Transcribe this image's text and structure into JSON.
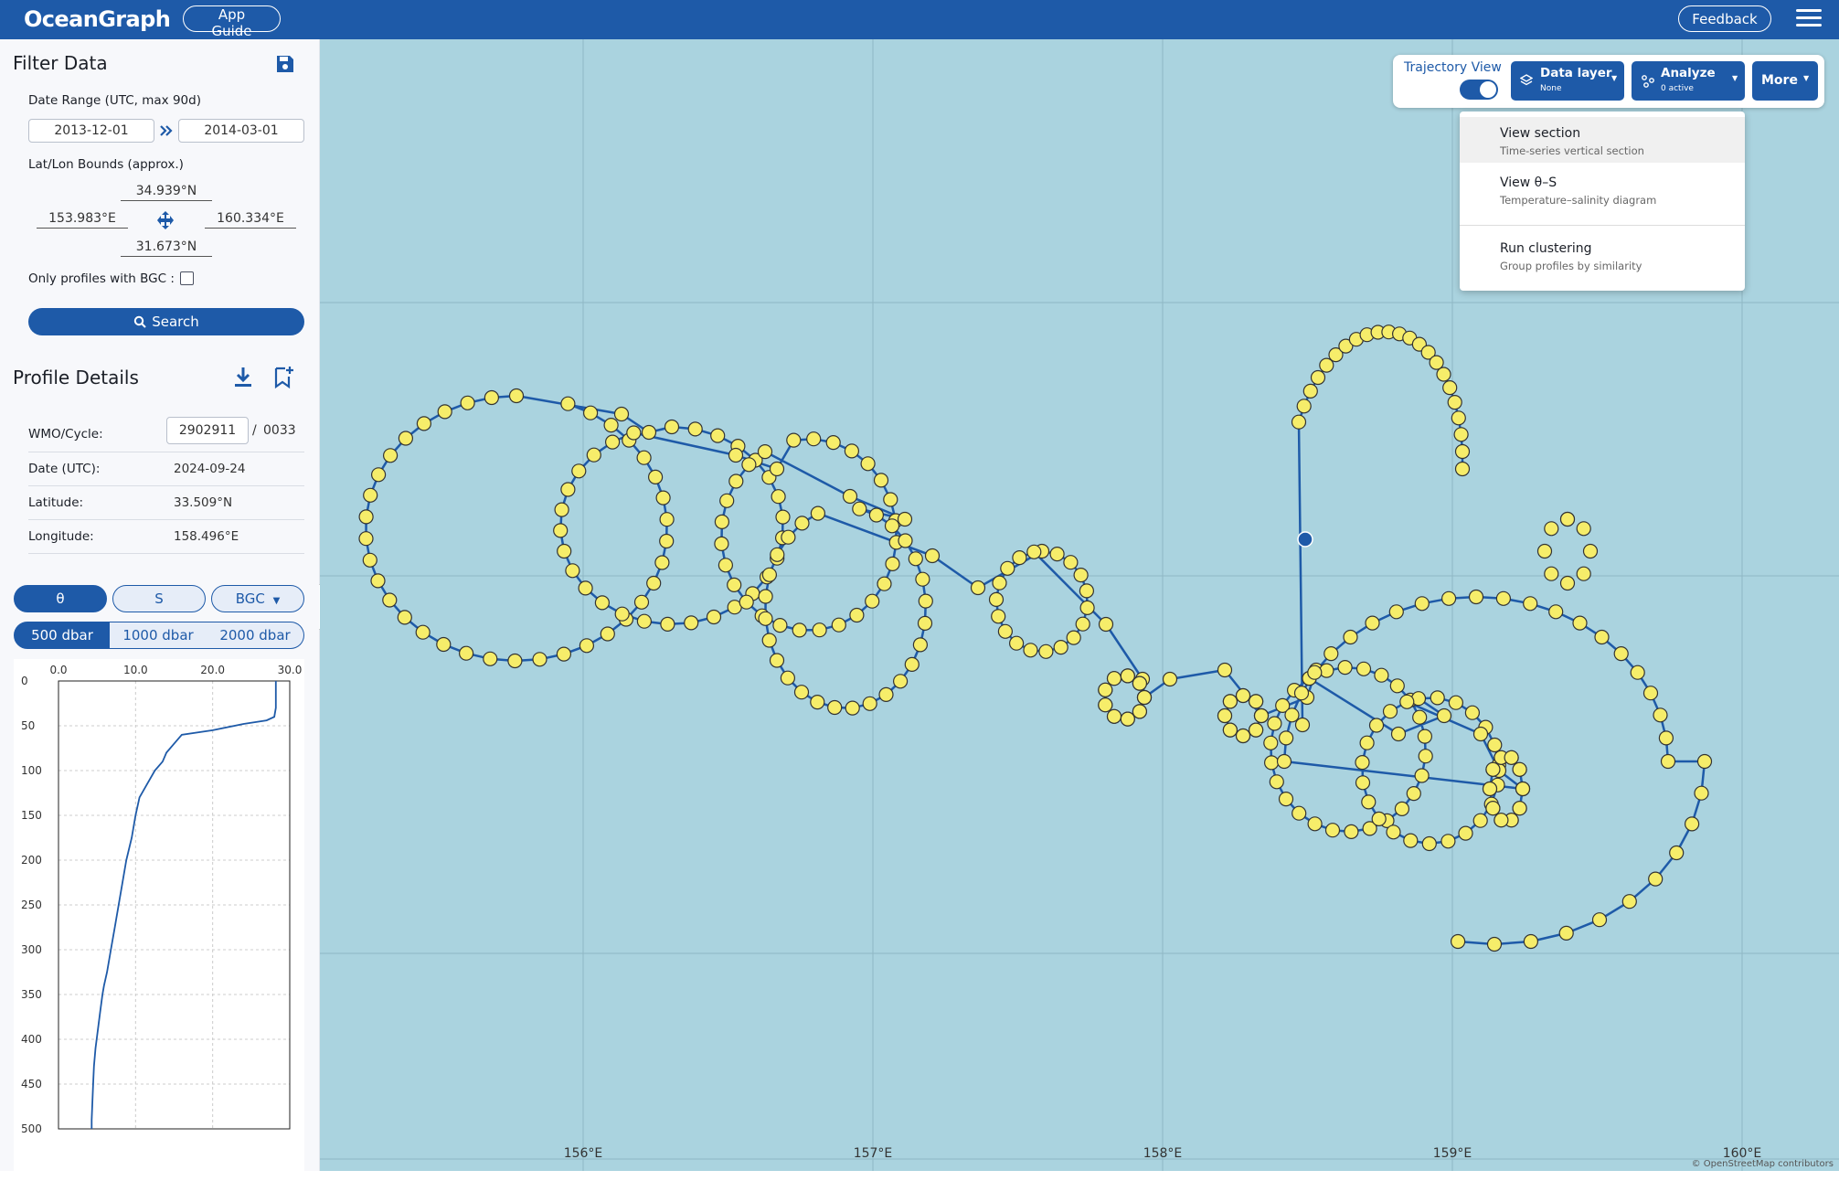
{
  "app": {
    "name": "OceanGraph",
    "guide_label": "App Guide",
    "feedback_label": "Feedback"
  },
  "filter": {
    "title": "Filter Data",
    "date_range_label": "Date Range (UTC, max 90d)",
    "date_start": "2013-12-01",
    "date_end": "2014-03-01",
    "bounds_label": "Lat/Lon Bounds (approx.)",
    "north": "34.939°N",
    "south": "31.673°N",
    "west": "153.983°E",
    "east": "160.334°E",
    "bgc_label": "Only profiles with BGC :",
    "bgc_checked": false,
    "search_label": "Search"
  },
  "profile": {
    "title": "Profile Details",
    "wmo_label": "WMO/Cycle:",
    "wmo": "2902911",
    "sep": "/",
    "cycle": "0033",
    "date_label": "Date (UTC):",
    "date": "2024-09-24",
    "lat_label": "Latitude:",
    "lat": "33.509°N",
    "lon_label": "Longitude:",
    "lon": "158.496°E"
  },
  "variables": [
    {
      "label": "θ",
      "active": true
    },
    {
      "label": "S",
      "active": false
    },
    {
      "label": "BGC",
      "active": false
    }
  ],
  "depths": [
    {
      "label": "500 dbar",
      "active": true
    },
    {
      "label": "1000 dbar",
      "active": false
    },
    {
      "label": "2000 dbar",
      "active": false
    }
  ],
  "chart_data": {
    "type": "line",
    "x_ticks": [
      "0.0",
      "10.0",
      "20.0",
      "30.0"
    ],
    "y_ticks": [
      "0",
      "50",
      "100",
      "150",
      "200",
      "250",
      "300",
      "350",
      "400",
      "450",
      "500"
    ],
    "xlim": [
      0,
      30
    ],
    "ylim": [
      0,
      500
    ],
    "y_inverted": true,
    "grid": true,
    "x": [
      28.2,
      28.2,
      28.0,
      27.0,
      24.0,
      20.0,
      16.0,
      15.0,
      14.0,
      13.5,
      12.5,
      11.5,
      10.5,
      10.0,
      9.5,
      8.8,
      8.3,
      7.8,
      7.3,
      6.8,
      6.3,
      5.9,
      5.7,
      5.4,
      5.1,
      4.8,
      4.6,
      4.5,
      4.4,
      4.3,
      4.3
    ],
    "y": [
      0,
      30,
      40,
      44,
      48,
      55,
      60,
      70,
      80,
      90,
      100,
      115,
      130,
      150,
      175,
      200,
      225,
      250,
      275,
      300,
      325,
      340,
      350,
      370,
      390,
      410,
      430,
      450,
      470,
      490,
      500
    ],
    "color": "#1e5aa8"
  },
  "map": {
    "trajectory_label": "Trajectory View",
    "trajectory_on": true,
    "data_layer_label": "Data layer",
    "data_layer_value": "None",
    "analyze_label": "Analyze",
    "analyze_value": "0 active",
    "more_label": "More",
    "lon_ticks": [
      "156°E",
      "157°E",
      "158°E",
      "159°E",
      "160°E"
    ],
    "attribution": "© OpenStreetMap contributors",
    "menu": [
      {
        "title": "View section",
        "subtitle": "Time-series vertical section",
        "highlighted": true
      },
      {
        "title": "View θ–S",
        "subtitle": "Temperature–salinity diagram",
        "highlighted": false
      },
      {
        "title": "Run clustering",
        "subtitle": "Group profiles by similarity",
        "highlighted": false
      }
    ],
    "line_color": "#1e5aa8",
    "marker_color": "#f6ed6a",
    "selected_color": "#1e5aa8",
    "ocean_color": "#aad3df"
  }
}
